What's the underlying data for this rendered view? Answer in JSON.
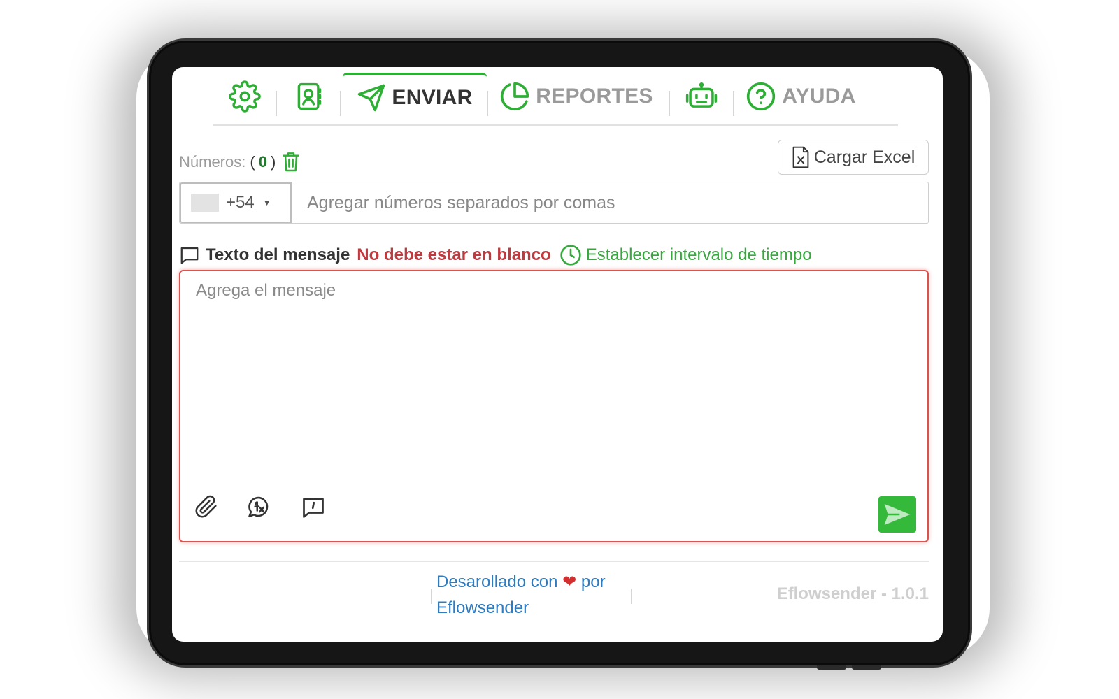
{
  "nav": {
    "tabs": [
      {
        "icon": "gear-icon",
        "label": ""
      },
      {
        "icon": "contacts-icon",
        "label": ""
      },
      {
        "icon": "send-icon",
        "label": "ENVIAR",
        "active": true
      },
      {
        "icon": "pie-chart-icon",
        "label": "REPORTES"
      },
      {
        "icon": "robot-icon",
        "label": ""
      },
      {
        "icon": "help-circle-icon",
        "label": "AYUDA"
      }
    ]
  },
  "numbers": {
    "label": "Números:",
    "open": "(",
    "count": "0",
    "close": ")"
  },
  "excel_button": {
    "label": "Cargar Excel"
  },
  "phone": {
    "country_code": "+54",
    "placeholder": "Agregar números separados por comas"
  },
  "message": {
    "title": "Texto del mensaje",
    "error": "No debe estar en blanco",
    "interval_link": "Establecer intervalo de tiempo",
    "placeholder": "Agrega el mensaje"
  },
  "footer": {
    "credit_prefix": "Desarollado con",
    "credit_suffix": "por",
    "credit_brand": "Eflowsender",
    "version": "Eflowsender - 1.0.1"
  },
  "colors": {
    "accent_green": "#2eae35",
    "error_red": "#c0393f",
    "link_blue": "#2f7bbf"
  }
}
